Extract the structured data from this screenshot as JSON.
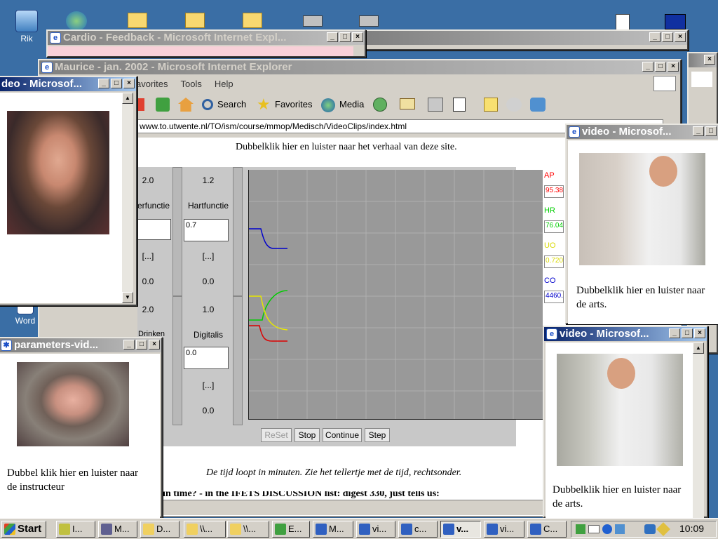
{
  "desktop_icons": [
    {
      "label": "Rik"
    },
    {
      "label": "Word"
    }
  ],
  "win_cardio": {
    "title": "Cardio - Feedback - Microsoft Internet Expl..."
  },
  "win_back": {
    "title": ""
  },
  "win_maurice": {
    "title": "Maurice - jan. 2002 - Microsoft Internet Explorer",
    "menu": [
      "avorites",
      "Tools",
      "Help"
    ],
    "toolbar": {
      "search": "Search",
      "favorites": "Favorites",
      "media": "Media"
    },
    "address": "www.to.utwente.nl/TO/ism/course/mmop/Medisch/VideoClips/index.html",
    "heading": "Dubbelklik hier en luister naar het verhaal van deze site.",
    "applet": {
      "col1": {
        "top": "2.0",
        "label": "erfunctie",
        "mid": "[...]",
        "val": "0.0",
        "bottom": "2.0",
        "label2": "Drinken"
      },
      "col2": {
        "top": "1.2",
        "label": "Hartfunctie",
        "input": "0.7",
        "mid": "[...]",
        "val": "0.0",
        "bottom": "1.0",
        "label2": "Digitalis",
        "input2": "0.0",
        "mid2": "[...]",
        "val2": "0.0"
      },
      "readouts": [
        {
          "label": "AP",
          "value": "95.38",
          "color": "#ff0000"
        },
        {
          "label": "HR",
          "value": "76.04",
          "color": "#00cc00"
        },
        {
          "label": "UO",
          "value": "0.720",
          "color": "#d8d800"
        },
        {
          "label": "CO",
          "value": "4460.",
          "color": "#0000cc"
        }
      ],
      "buttons": [
        "ReSet",
        "Stop",
        "Continue",
        "Step"
      ]
    },
    "caption": "De tijd loopt in minuten. Zie het tellertje met de tijd, rechtsonder.",
    "truncated_text": "just in time? - in the IFETS DISCUSSION list: digest 330, just tells us:"
  },
  "win_video_left": {
    "title": "deo - Microsof..."
  },
  "win_params": {
    "title": "parameters-vid...",
    "text": "Dubbel klik hier en luister naar de instructeur"
  },
  "win_video_r1": {
    "title": "video - Microsof...",
    "text": "Dubbelklik hier en luister naar de arts."
  },
  "win_video_r2": {
    "title": "video - Microsof...",
    "text": "Dubbelklik hier en luister naar de arts."
  },
  "taskbar": {
    "start": "Start",
    "buttons": [
      "I...",
      "M...",
      "D...",
      "\\\\...",
      "\\\\...",
      "E...",
      "M...",
      "vi...",
      "c...",
      "v...",
      "vi...",
      "C..."
    ],
    "clock": "10:09"
  }
}
